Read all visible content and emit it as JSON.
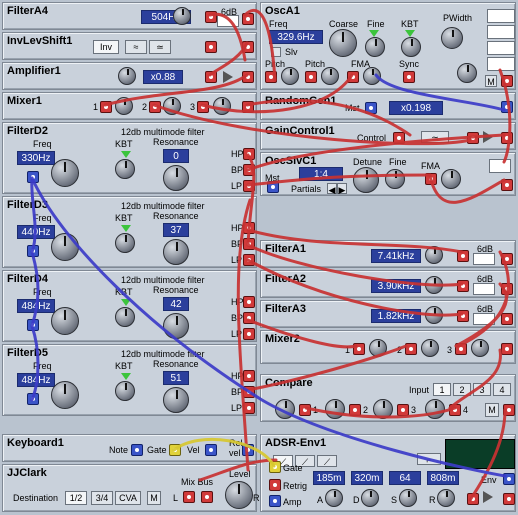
{
  "modules": {
    "filtera4": {
      "title": "FilterA4",
      "freq": "504Hz",
      "db": "6dB"
    },
    "invlevshift1": {
      "title": "InvLevShift1",
      "inv": "Inv"
    },
    "amplifier1": {
      "title": "Amplifier1",
      "gain": "x0.88"
    },
    "mixer1": {
      "title": "Mixer1",
      "in1": "1",
      "in2": "2",
      "in3": "3"
    },
    "filterd2": {
      "title": "FilterD2",
      "subtitle": "12db multimode filter",
      "freq_label": "Freq",
      "freq": "330Hz",
      "kbt": "KBT",
      "res_label": "Resonance",
      "res": "0",
      "hp": "HP",
      "bp": "BP",
      "lp": "LP"
    },
    "filterd3": {
      "title": "FilterD3",
      "subtitle": "12db multimode filter",
      "freq_label": "Freq",
      "freq": "440Hz",
      "kbt": "KBT",
      "res_label": "Resonance",
      "res": "37",
      "hp": "HP",
      "bp": "BP",
      "lp": "LP"
    },
    "filterd4": {
      "title": "FilterD4",
      "subtitle": "12db multimode filter",
      "freq_label": "Freq",
      "freq": "484Hz",
      "kbt": "KBT",
      "res_label": "Resonance",
      "res": "42",
      "hp": "HP",
      "bp": "BP",
      "lp": "LP"
    },
    "filterd5": {
      "title": "FilterD5",
      "subtitle": "12db multimode filter",
      "freq_label": "Freq",
      "freq": "484Hz",
      "kbt": "KBT",
      "res_label": "Resonance",
      "res": "51",
      "hp": "HP",
      "bp": "BP",
      "lp": "LP"
    },
    "keyboard1": {
      "title": "Keyboard1",
      "note": "Note",
      "gate": "Gate",
      "vel": "Vel",
      "rel": "Rel",
      "rel2": "vel"
    },
    "jjclark": {
      "title": "JJClark",
      "destination": "Destination",
      "opt1": "1/2",
      "opt2": "3/4",
      "opt3": "CVA",
      "m": "M",
      "mixbus": "Mix Bus",
      "level": "Level",
      "l": "L",
      "r": "R"
    },
    "osca1": {
      "title": "OscA1",
      "freq_label": "Freq",
      "freq": "329.6Hz",
      "slv": "Slv",
      "coarse": "Coarse",
      "fine": "Fine",
      "kbt": "KBT",
      "pwidth": "PWidth",
      "pitch1": "Pitch",
      "pitch2": "Pitch",
      "fma": "FMA",
      "sync": "Sync",
      "m": "M"
    },
    "randomgen1": {
      "title": "RandomGen1",
      "mst": "Mst",
      "rate": "x0.198"
    },
    "gaincontrol1": {
      "title": "GainControl1",
      "control": "Control"
    },
    "oscslvc1": {
      "title": "OscSlvC1",
      "mst": "Mst",
      "ratio": "1:4",
      "partials": "Partials",
      "detune": "Detune",
      "fine": "Fine",
      "fma": "FMA"
    },
    "filtera1": {
      "title": "FilterA1",
      "freq": "7.41kHz",
      "db": "6dB"
    },
    "filtera2": {
      "title": "FilterA2",
      "freq": "3.90kHz",
      "db": "6dB"
    },
    "filtera3": {
      "title": "FilterA3",
      "freq": "1.82kHz",
      "db": "6dB"
    },
    "mixer2": {
      "title": "Mixer2",
      "in1": "1",
      "in2": "2",
      "in3": "3"
    },
    "compare": {
      "title": "Compare",
      "input_label": "Input",
      "opts": [
        "1",
        "2",
        "3",
        "4"
      ],
      "j1": "1",
      "j2": "2",
      "j3": "3",
      "j4": "4",
      "m": "M"
    },
    "adsr": {
      "title": "ADSR-Env1",
      "gate": "Gate",
      "retrig": "Retrig",
      "amp": "Amp",
      "a_time": "185m",
      "d_time": "320m",
      "s_level": "64",
      "r_time": "808m",
      "a": "A",
      "d": "D",
      "s": "S",
      "r": "R",
      "env": "Env"
    }
  },
  "colors": {
    "cable_red": "#c83232",
    "cable_blue": "#3c3cc8",
    "cable_yellow": "#d8c830",
    "display": "#2b3f9c",
    "panel": "#c9d1db"
  }
}
